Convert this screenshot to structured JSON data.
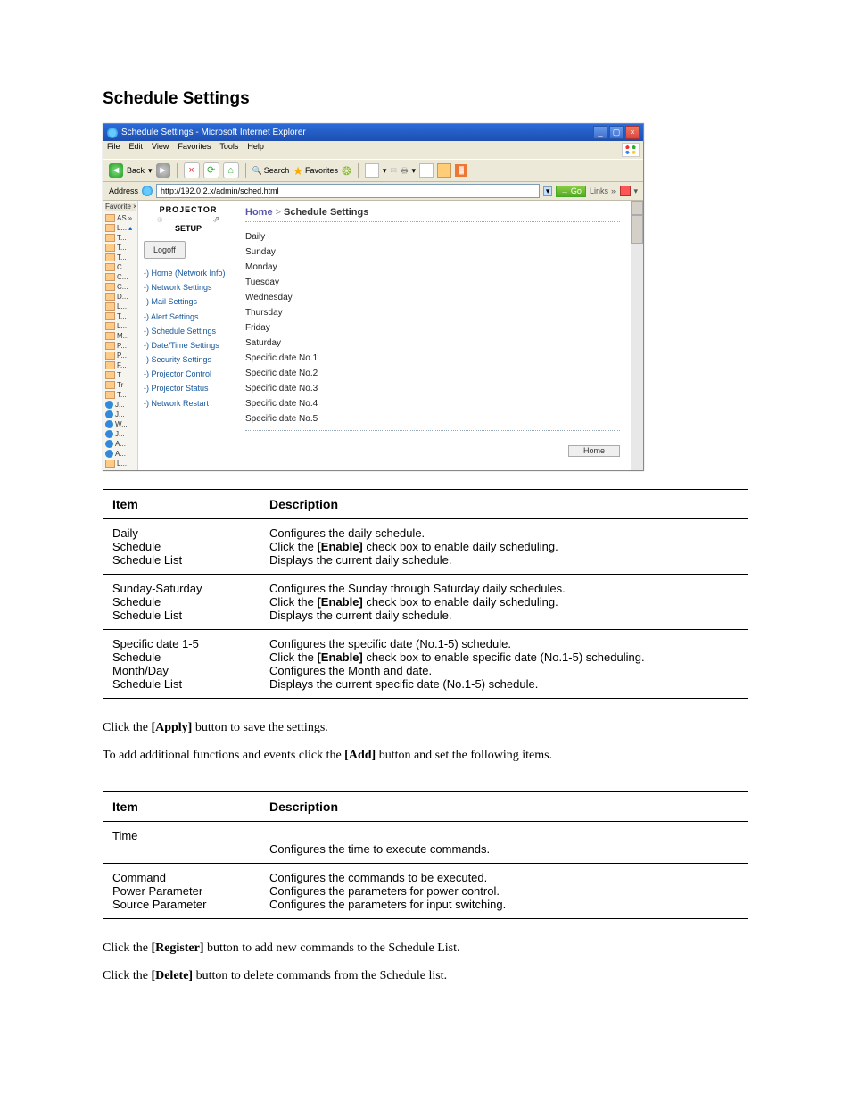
{
  "heading": "Schedule Settings",
  "browser": {
    "title": "Schedule Settings - Microsoft Internet Explorer",
    "menu": [
      "File",
      "Edit",
      "View",
      "Favorites",
      "Tools",
      "Help"
    ],
    "toolbar": {
      "back": "Back",
      "search": "Search",
      "favorites": "Favorites"
    },
    "address_label": "Address",
    "address_value": "http://192.0.2.x/admin/sched.html",
    "go": "Go",
    "links": "Links"
  },
  "favorites_strip": {
    "title": "Favorite",
    "items": [
      "AS",
      "L...",
      "T...",
      "T...",
      "T...",
      "C...",
      "C...",
      "C...",
      "D...",
      "L...",
      "T...",
      "L...",
      "M...",
      "P...",
      "P...",
      "F...",
      "T...",
      "Tr",
      "T...",
      "J...",
      "J...",
      "W...",
      "J...",
      "A...",
      "A...",
      "L..."
    ]
  },
  "projector_nav": {
    "brand_top": "PROJECTOR",
    "brand_bottom": "SETUP",
    "logoff": "Logoff",
    "links": [
      "Home (Network Info)",
      "Network Settings",
      "Mail Settings",
      "Alert Settings",
      "Schedule Settings",
      "Date/Time Settings",
      "Security Settings",
      "Projector Control",
      "Projector Status",
      "Network Restart"
    ]
  },
  "main_panel": {
    "breadcrumb_home": "Home",
    "breadcrumb_current": "Schedule Settings",
    "days": [
      "Daily",
      "Sunday",
      "Monday",
      "Tuesday",
      "Wednesday",
      "Thursday",
      "Friday",
      "Saturday",
      "Specific date No.1",
      "Specific date No.2",
      "Specific date No.3",
      "Specific date No.4",
      "Specific date No.5"
    ],
    "home_btn": "Home"
  },
  "table1": {
    "headers": [
      "Item",
      "Description"
    ],
    "rows": [
      {
        "item": [
          "Daily",
          "Schedule",
          "Schedule List"
        ],
        "desc": [
          "Configures the daily schedule.",
          "Click the [Enable] check box to enable daily scheduling.",
          "Displays the current daily schedule."
        ]
      },
      {
        "item": [
          "Sunday-Saturday",
          "Schedule",
          "Schedule List"
        ],
        "desc": [
          "Configures the Sunday through Saturday daily schedules.",
          "Click the [Enable] check box to enable daily scheduling.",
          "Displays the current daily schedule."
        ]
      },
      {
        "item": [
          "Specific date 1-5",
          "Schedule",
          "Month/Day",
          "Schedule List"
        ],
        "desc": [
          "Configures the specific date (No.1-5) schedule.",
          "Click the [Enable] check box to enable specific date (No.1-5) scheduling.",
          "Configures the Month and date.",
          "Displays the current specific date (No.1-5) schedule."
        ]
      }
    ]
  },
  "para1_a": "Click the ",
  "para1_b": "[Apply]",
  "para1_c": " button to save the settings.",
  "para2_a": "To add additional functions and events click the ",
  "para2_b": "[Add]",
  "para2_c": " button and set the following items.",
  "table2": {
    "headers": [
      "Item",
      "Description"
    ],
    "rows": [
      {
        "item": [
          "Time"
        ],
        "desc": [
          "Configures the time to execute commands."
        ]
      },
      {
        "item": [
          "Command",
          "Power Parameter",
          "Source Parameter"
        ],
        "desc": [
          "Configures the commands to be executed.",
          "Configures the parameters for power control.",
          "Configures the parameters for input switching."
        ]
      }
    ]
  },
  "para3_a": "Click the ",
  "para3_b": "[Register]",
  "para3_c": " button to add new commands to the Schedule List.",
  "para4_a": "Click the ",
  "para4_b": "[Delete]",
  "para4_c": " button to delete commands from the Schedule list."
}
